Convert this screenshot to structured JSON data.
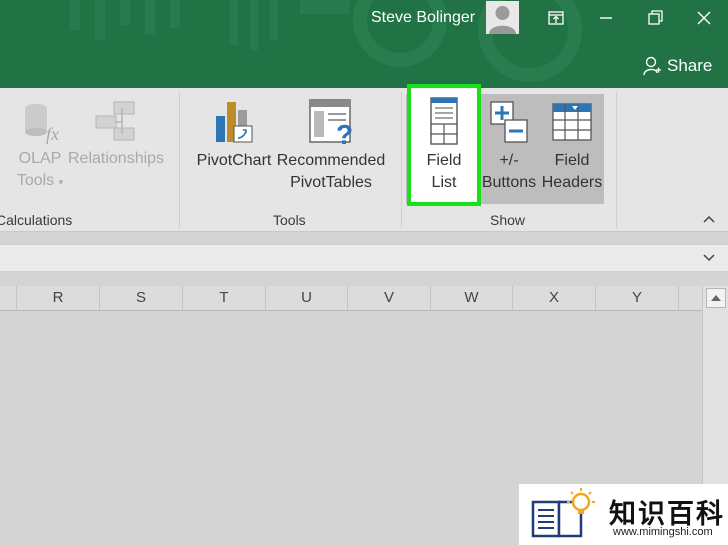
{
  "title_bar": {
    "user_name": "Steve Bolinger",
    "share_label": "Share",
    "background": "#217346"
  },
  "ribbon": {
    "groups": [
      {
        "label": "Calculations",
        "buttons": [
          {
            "label_line1": "OLAP",
            "label_line2": "Tools",
            "icon": "olap-tools-icon",
            "enabled": false,
            "has_dropdown": true
          },
          {
            "label_line1": "Relationships",
            "icon": "relationships-icon",
            "enabled": false
          }
        ]
      },
      {
        "label": "Tools",
        "buttons": [
          {
            "label_line1": "PivotChart",
            "icon": "pivotchart-icon",
            "enabled": true
          },
          {
            "label_line1": "Recommended",
            "label_line2": "PivotTables",
            "icon": "recommended-pivottables-icon",
            "enabled": true
          }
        ]
      },
      {
        "label": "Show",
        "buttons": [
          {
            "label_line1": "Field",
            "label_line2": "List",
            "icon": "field-list-icon",
            "enabled": true,
            "highlighted": true
          },
          {
            "label_line1": "+/-",
            "label_line2": "Buttons",
            "icon": "plus-minus-buttons-icon",
            "enabled": true,
            "active": true
          },
          {
            "label_line1": "Field",
            "label_line2": "Headers",
            "icon": "field-headers-icon",
            "enabled": true,
            "active": true
          }
        ]
      }
    ],
    "highlight_color": "#19e019"
  },
  "columns": [
    "R",
    "S",
    "T",
    "U",
    "V",
    "W",
    "X",
    "Y"
  ],
  "watermark": {
    "title": "知识百科",
    "url": "www.mimingshi.com"
  }
}
